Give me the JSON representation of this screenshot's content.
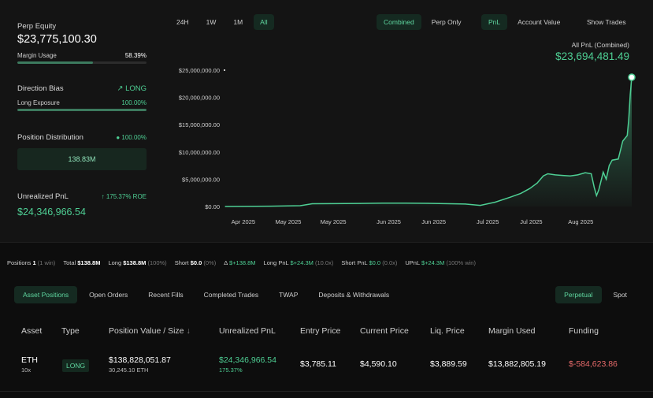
{
  "stats": {
    "perp_equity_label": "Perp Equity",
    "perp_equity_value": "$23,775,100.30",
    "margin_usage_label": "Margin Usage",
    "margin_usage_value": "58.39%",
    "margin_usage_fraction": 0.5839,
    "direction_bias_label": "Direction Bias",
    "direction_bias_value": "LONG",
    "long_exposure_label": "Long Exposure",
    "long_exposure_value": "100.00%",
    "long_exposure_fraction": 1.0,
    "position_distribution_label": "Position Distribution",
    "position_distribution_value": "100.00%",
    "position_distribution_amount": "138.83M",
    "unrealized_pnl_label": "Unrealized PnL",
    "unrealized_roe": "175.37% ROE",
    "unrealized_pnl_value": "$24,346,966.54"
  },
  "time_tabs": [
    {
      "label": "24H",
      "active": false
    },
    {
      "label": "1W",
      "active": false
    },
    {
      "label": "1M",
      "active": false
    },
    {
      "label": "All",
      "active": true
    }
  ],
  "view_tabs": [
    {
      "label": "Combined",
      "active": true
    },
    {
      "label": "Perp Only",
      "active": false
    }
  ],
  "metric_tabs": [
    {
      "label": "PnL",
      "active": true
    },
    {
      "label": "Account Value",
      "active": false
    }
  ],
  "show_trades_label": "Show Trades",
  "chart_header": {
    "title": "All PnL (Combined)",
    "total": "$23,694,481.49"
  },
  "chart_data": {
    "type": "area",
    "title": "All PnL (Combined)",
    "y_ticks": [
      "$0.00",
      "$5,000,000.00",
      "$10,000,000.00",
      "$15,000,000.00",
      "$20,000,000.00",
      "$25,000,000.00"
    ],
    "y_tick_values": [
      0,
      5000000,
      10000000,
      15000000,
      20000000,
      25000000
    ],
    "ylim": [
      0,
      25000000
    ],
    "x_ticks": [
      "Apr 2025",
      "May 2025",
      "May 2025",
      "Jun 2025",
      "Jun 2025",
      "Jul 2025",
      "Jul 2025",
      "Aug 2025"
    ],
    "x_tick_days": [
      12,
      42,
      72,
      109,
      139,
      175,
      204,
      237
    ],
    "x": [
      0,
      30,
      50,
      58,
      70,
      90,
      105,
      120,
      135,
      150,
      160,
      170,
      180,
      190,
      197,
      203,
      208,
      212,
      215,
      220,
      225,
      230,
      235,
      240,
      244,
      246,
      247.5,
      249,
      252,
      254,
      256,
      258,
      262,
      265,
      268,
      269,
      270,
      271
    ],
    "y": [
      0,
      60000,
      150000,
      500000,
      520000,
      560000,
      600000,
      620000,
      580000,
      500000,
      450000,
      200000,
      800000,
      1700000,
      2400000,
      3300000,
      4300000,
      5600000,
      6000000,
      5800000,
      5700000,
      5600000,
      5800000,
      6200000,
      6000000,
      3500000,
      2000000,
      3000000,
      6300000,
      5000000,
      7500000,
      8500000,
      8700000,
      12000000,
      13000000,
      16000000,
      20500000,
      23694481.49
    ],
    "grid": false,
    "line_color": "#4ecf94"
  },
  "summary": {
    "positions_label": "Positions",
    "positions_value": "1",
    "positions_note": "(1 win)",
    "total_label": "Total",
    "total_value": "$138.8M",
    "long_label": "Long",
    "long_value": "$138.8M",
    "long_note": "(100%)",
    "short_label": "Short",
    "short_value": "$0.0",
    "short_note": "(0%)",
    "delta_label": "Δ",
    "delta_value": "$+138.8M",
    "long_pnl_label": "Long PnL",
    "long_pnl_value": "$+24.3M",
    "long_pnl_note": "(10.0x)",
    "short_pnl_label": "Short PnL",
    "short_pnl_value": "$0.0",
    "short_pnl_note": "(0.0x)",
    "upnl_label": "UPnL",
    "upnl_value": "$+24.3M",
    "upnl_note": "(100% win)"
  },
  "section_tabs": [
    {
      "label": "Asset Positions",
      "active": true
    },
    {
      "label": "Open Orders",
      "active": false
    },
    {
      "label": "Recent Fills",
      "active": false
    },
    {
      "label": "Completed Trades",
      "active": false
    },
    {
      "label": "TWAP",
      "active": false
    },
    {
      "label": "Deposits & Withdrawals",
      "active": false
    }
  ],
  "market_tabs": [
    {
      "label": "Perpetual",
      "active": true
    },
    {
      "label": "Spot",
      "active": false
    }
  ],
  "table": {
    "headers": {
      "asset": "Asset",
      "type": "Type",
      "position_value": "Position Value / Size",
      "sort_arrow": "↓",
      "unrealized_pnl": "Unrealized PnL",
      "entry_price": "Entry Price",
      "current_price": "Current Price",
      "liq_price": "Liq. Price",
      "margin_used": "Margin Used",
      "funding": "Funding"
    },
    "row": {
      "asset": "ETH",
      "leverage": "10x",
      "type": "LONG",
      "position_value": "$138,828,051.87",
      "position_size": "30,245.10 ETH",
      "unrealized_pnl": "$24,346,966.54",
      "unrealized_pct": "175.37%",
      "entry_price": "$3,785.11",
      "current_price": "$4,590.10",
      "liq_price": "$3,889.59",
      "margin_used": "$13,882,805.19",
      "funding": "$-584,623.86"
    }
  }
}
